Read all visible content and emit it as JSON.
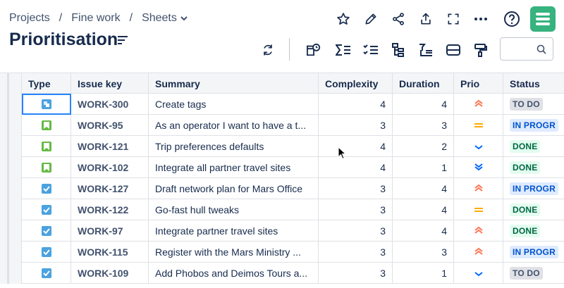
{
  "breadcrumb": {
    "items": [
      "Projects",
      "Fine work",
      "Sheets"
    ],
    "separator": "/"
  },
  "page": {
    "title": "Prioritisation"
  },
  "search": {
    "placeholder": ""
  },
  "colors": {
    "accent": "#2684ff",
    "brand": "#36b37e",
    "story": "#65ba43",
    "task": "#4ba2e0",
    "subtask": "#4ba2e0"
  },
  "table": {
    "columns": [
      "Type",
      "Issue key",
      "Summary",
      "Complexity",
      "Duration",
      "Prio",
      "Status"
    ],
    "rows": [
      {
        "type": "subtask",
        "key": "WORK-300",
        "summary": "Create tags",
        "complexity": "4",
        "duration": "4",
        "prio": "high",
        "status": "TO DO",
        "status_kind": "todo"
      },
      {
        "type": "story",
        "key": "WORK-95",
        "summary": "As an operator I want to have a t...",
        "complexity": "3",
        "duration": "3",
        "prio": "medium",
        "status": "IN PROGR",
        "status_kind": "prog"
      },
      {
        "type": "story",
        "key": "WORK-121",
        "summary": "Trip preferences defaults",
        "complexity": "4",
        "duration": "2",
        "prio": "low",
        "status": "DONE",
        "status_kind": "done"
      },
      {
        "type": "story",
        "key": "WORK-102",
        "summary": "Integrate all partner travel sites",
        "complexity": "4",
        "duration": "1",
        "prio": "lowest",
        "status": "DONE",
        "status_kind": "done"
      },
      {
        "type": "task",
        "key": "WORK-127",
        "summary": "Draft network plan for Mars Office",
        "complexity": "3",
        "duration": "4",
        "prio": "high",
        "status": "IN PROGR",
        "status_kind": "prog"
      },
      {
        "type": "task",
        "key": "WORK-122",
        "summary": "Go-fast hull tweaks",
        "complexity": "3",
        "duration": "4",
        "prio": "medium",
        "status": "DONE",
        "status_kind": "done"
      },
      {
        "type": "task",
        "key": "WORK-97",
        "summary": "Integrate partner travel sites",
        "complexity": "3",
        "duration": "4",
        "prio": "high",
        "status": "DONE",
        "status_kind": "done"
      },
      {
        "type": "task",
        "key": "WORK-115",
        "summary": "Register with the Mars Ministry ...",
        "complexity": "3",
        "duration": "3",
        "prio": "high",
        "status": "IN PROGR",
        "status_kind": "prog"
      },
      {
        "type": "task",
        "key": "WORK-109",
        "summary": "Add Phobos and Deimos Tours a...",
        "complexity": "3",
        "duration": "1",
        "prio": "low",
        "status": "TO DO",
        "status_kind": "todo"
      }
    ]
  }
}
